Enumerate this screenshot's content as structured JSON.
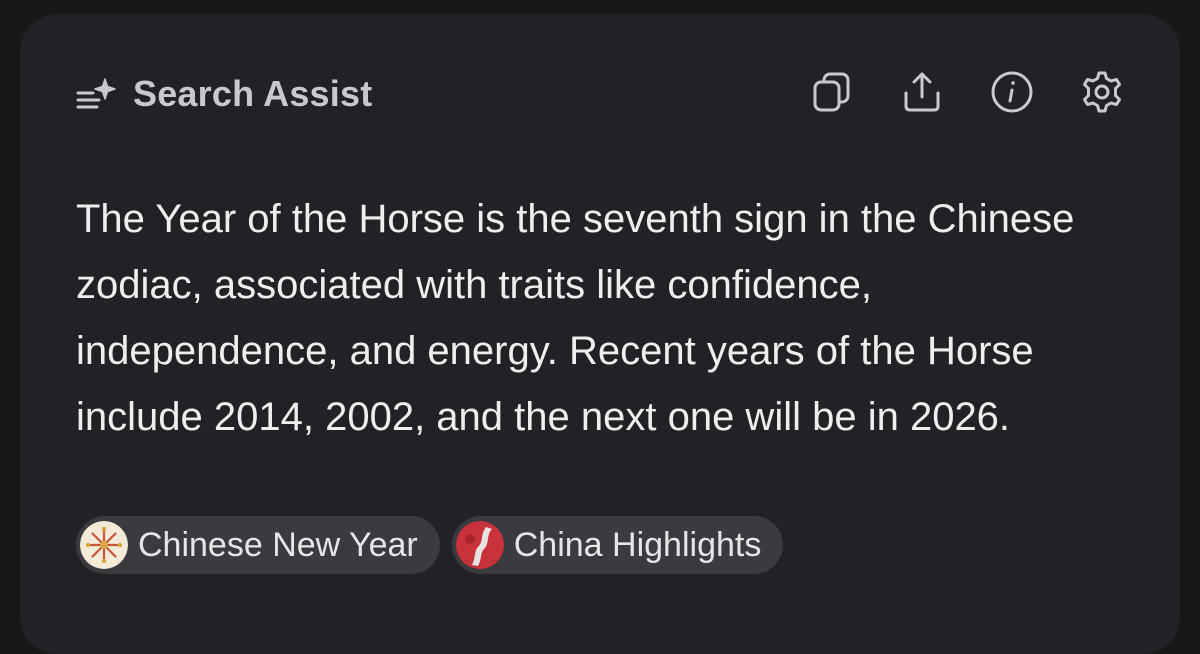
{
  "header": {
    "title": "Search Assist",
    "icon": "sparkle-list-icon",
    "actions": [
      {
        "name": "copy",
        "icon": "copy-icon"
      },
      {
        "name": "share",
        "icon": "share-icon"
      },
      {
        "name": "info",
        "icon": "info-icon"
      },
      {
        "name": "settings",
        "icon": "gear-icon"
      }
    ]
  },
  "answer": {
    "text": "The Year of the Horse is the seventh sign in the Chinese zodiac, associated with traits like confidence, independence, and energy. Recent years of the Horse include 2014, 2002, and the next one will be in 2026."
  },
  "sources": [
    {
      "label": "Chinese New Year",
      "icon": "chinese-new-year-favicon"
    },
    {
      "label": "China Highlights",
      "icon": "china-highlights-favicon"
    }
  ],
  "colors": {
    "background": "#181819",
    "card": "#222226",
    "chip": "#3a3a3f",
    "text": "#eeeeef",
    "muted": "#c9c9cd"
  }
}
